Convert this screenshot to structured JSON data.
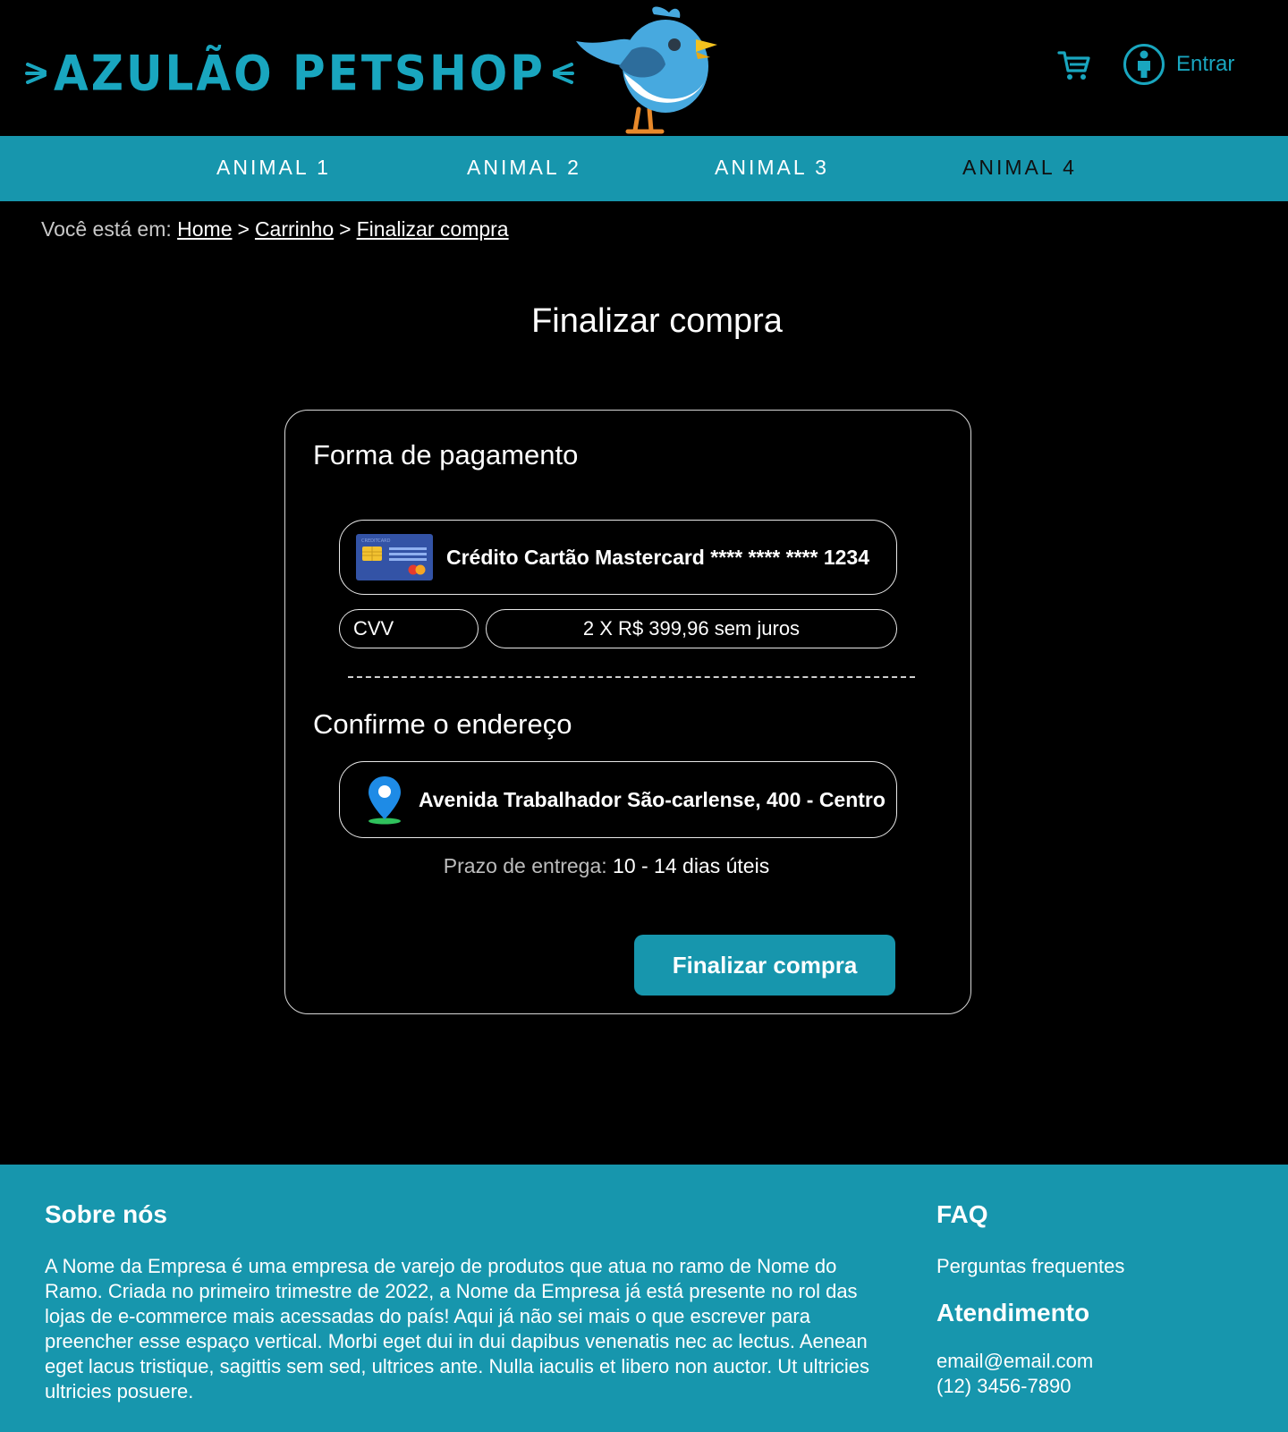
{
  "brand": {
    "name": "AZULÃO PETSHOP"
  },
  "header": {
    "cart_icon": "cart-icon",
    "account_icon": "user-circle-icon",
    "login_label": "Entrar"
  },
  "nav": {
    "items": [
      {
        "label": "ANIMAL 1"
      },
      {
        "label": "ANIMAL 2"
      },
      {
        "label": "ANIMAL 3"
      },
      {
        "label": "ANIMAL 4"
      }
    ]
  },
  "breadcrumb": {
    "prefix": "Você está em:",
    "items": [
      "Home",
      "Carrinho",
      "Finalizar compra"
    ],
    "separator": ">"
  },
  "page": {
    "title": "Finalizar compra"
  },
  "checkout": {
    "payment_title": "Forma de pagamento",
    "card_label": "CREDITCARD",
    "payment_method": "Crédito Cartão Mastercard **** **** **** 1234",
    "cvv_placeholder": "CVV",
    "installments": "2 X R$ 399,96 sem juros",
    "address_title": "Confirme o endereço",
    "address": "Avenida Trabalhador São-carlense, 400 - Centro",
    "delivery_label": "Prazo de entrega:",
    "delivery_value": "10 - 14 dias úteis",
    "submit_label": "Finalizar compra"
  },
  "footer": {
    "about_title": "Sobre nós",
    "about_text": "A Nome da Empresa é uma empresa de varejo de produtos que atua no ramo de Nome do Ramo. Criada no primeiro trimestre de 2022, a Nome da Empresa já está presente no rol das  lojas de e-commerce mais acessadas do país! Aqui já não sei mais o que escrever para preencher esse espaço vertical. Morbi eget dui in dui dapibus venenatis nec ac lectus. Aenean eget lacus tristique, sagittis sem sed, ultrices ante. Nulla iaculis et libero non auctor. Ut ultricies ultricies posuere.",
    "faq_title": "FAQ",
    "faq_link": "Perguntas frequentes",
    "support_title": "Atendimento",
    "email": "email@email.com",
    "phone": "(12) 3456-7890"
  },
  "colors": {
    "accent": "#1796ad",
    "logo": "#19a6bf",
    "background": "#000000"
  }
}
